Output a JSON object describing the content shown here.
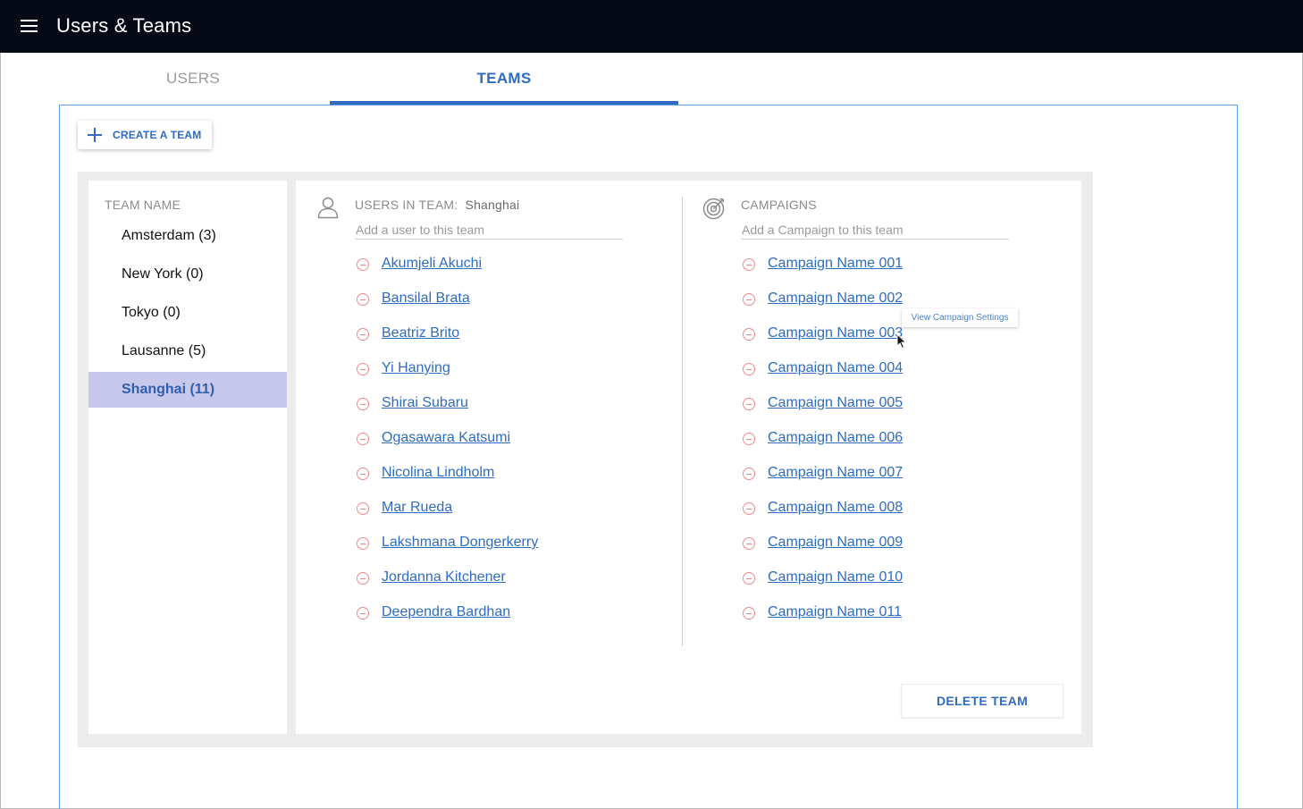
{
  "app": {
    "title": "Users & Teams",
    "menu_icon": "hamburger-menu-icon"
  },
  "tabs": [
    {
      "label": "USERS",
      "active": false
    },
    {
      "label": "TEAMS",
      "active": true
    }
  ],
  "colors": {
    "topbar": "#060a16",
    "accent": "#2f6cc0",
    "selected_team_bg": "#c8c8ec",
    "remove": "#ef8a8a"
  },
  "create_team": {
    "label": "CREATE A TEAM",
    "icon": "plus-icon"
  },
  "teams": {
    "header": "TEAM NAME",
    "items": [
      {
        "label": "Amsterdam (3)",
        "selected": false
      },
      {
        "label": "New York (0)",
        "selected": false
      },
      {
        "label": "Tokyo (0)",
        "selected": false
      },
      {
        "label": "Lausanne (5)",
        "selected": false
      },
      {
        "label": "Shanghai (11)",
        "selected": true
      }
    ]
  },
  "users_section": {
    "title": "USERS IN TEAM:",
    "team": "Shanghai",
    "icon": "user-icon",
    "add_placeholder": "Add a user to this team",
    "users": [
      "Akumjeli Akuchi",
      "Bansilal Brata",
      "Beatriz Brito",
      "Yi Hanying",
      "Shirai Subaru",
      "Ogasawara Katsumi",
      "Nicolina Lindholm",
      "Mar Rueda",
      "Lakshmana Dongerkerry",
      "Jordanna Kitchener",
      "Deependra Bardhan"
    ]
  },
  "campaigns_section": {
    "title": "CAMPAIGNS",
    "icon": "target-icon",
    "add_placeholder": "Add a Campaign to this team",
    "campaigns": [
      "Campaign Name 001",
      "Campaign Name 002",
      "Campaign Name 003",
      "Campaign Name 004",
      "Campaign Name 005",
      "Campaign Name 006",
      "Campaign Name 007",
      "Campaign Name 008",
      "Campaign Name 009",
      "Campaign Name 010",
      "Campaign Name 011"
    ]
  },
  "tooltip": {
    "text": "View Campaign Settings"
  },
  "delete_team": {
    "label": "DELETE TEAM"
  }
}
